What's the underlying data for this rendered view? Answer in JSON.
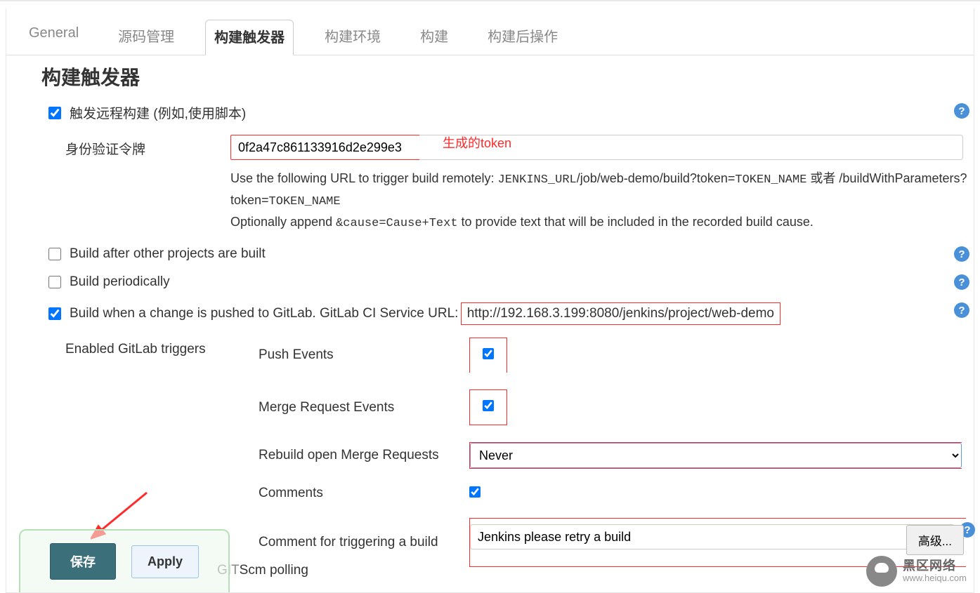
{
  "tabs": {
    "general": "General",
    "scm": "源码管理",
    "triggers": "构建触发器",
    "env": "构建环境",
    "build": "构建",
    "postbuild": "构建后操作"
  },
  "triggers": {
    "section_title": "构建触发器",
    "remote": {
      "label": "触发远程构建 (例如,使用脚本)",
      "checked": true,
      "token_label": "身份验证令牌",
      "token_value": "0f2a47c861133916d2e299e3",
      "annotation": "生成的token",
      "help_line1_pre": "Use the following URL to trigger build remotely: ",
      "help_line1_code": "JENKINS_URL",
      "help_line1_mid": "/job/web-demo/build?token=",
      "help_line1_code2": "TOKEN_NAME",
      "help_line1_post": " 或者 /buildWithParameters?token=",
      "help_line1_code3": "TOKEN_NAME",
      "help_line2_pre": "Optionally append ",
      "help_line2_code": "&cause=Cause+Text",
      "help_line2_post": " to provide text that will be included in the recorded build cause."
    },
    "build_after": {
      "label": "Build after other projects are built",
      "checked": false
    },
    "periodic": {
      "label": "Build periodically",
      "checked": false
    },
    "gitlab": {
      "label_pre": "Build when a change is pushed to GitLab. GitLab CI Service URL:",
      "url": "http://192.168.3.199:8080/jenkins/project/web-demo",
      "checked": true,
      "enabled_label": "Enabled GitLab triggers",
      "push_events": {
        "label": "Push Events",
        "checked": true
      },
      "merge_events": {
        "label": "Merge Request Events",
        "checked": true
      },
      "rebuild_label": "Rebuild open Merge Requests",
      "rebuild_value": "Never",
      "comments": {
        "label": "Comments",
        "checked": true
      },
      "comment_trigger_label": "Comment for triggering a build",
      "comment_trigger_value": "Jenkins please retry a build"
    },
    "scm_polling_fragment": "Scm polling"
  },
  "buttons": {
    "advanced": "高级...",
    "save": "保存",
    "apply": "Apply"
  },
  "watermark": {
    "title": "黑区网络",
    "url": "www.heiqu.com"
  },
  "help_icon": "?"
}
